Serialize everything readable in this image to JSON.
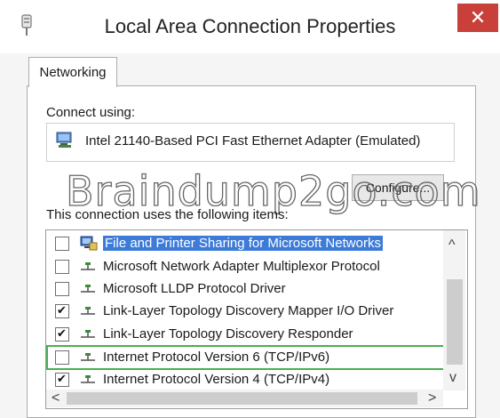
{
  "window": {
    "title": "Local Area Connection Properties",
    "close_glyph": "✕",
    "accent_close": "#c9403a"
  },
  "tabs": [
    {
      "label": "Networking",
      "active": true
    }
  ],
  "connect": {
    "label": "Connect using:",
    "adapter_name": "Intel 21140-Based PCI Fast Ethernet Adapter (Emulated)",
    "configure_label": "Configure..."
  },
  "watermark": "Braindump2go.com",
  "items": {
    "label": "This connection uses the following items:",
    "list": [
      {
        "label": "File and Printer Sharing for Microsoft Networks",
        "checked": false,
        "icon": "network-share-icon",
        "selected": true
      },
      {
        "label": "Microsoft Network Adapter Multiplexor Protocol",
        "checked": false,
        "icon": "protocol-icon"
      },
      {
        "label": "Microsoft LLDP Protocol Driver",
        "checked": false,
        "icon": "protocol-icon"
      },
      {
        "label": "Link-Layer Topology Discovery Mapper I/O Driver",
        "checked": true,
        "icon": "protocol-icon"
      },
      {
        "label": "Link-Layer Topology Discovery Responder",
        "checked": true,
        "icon": "protocol-icon"
      },
      {
        "label": "Internet Protocol Version 6 (TCP/IPv6)",
        "checked": false,
        "icon": "protocol-icon",
        "highlighted": true
      },
      {
        "label": "Internet Protocol Version 4 (TCP/IPv4)",
        "checked": true,
        "icon": "protocol-icon"
      }
    ]
  },
  "scroll": {
    "up": "^",
    "down": "v",
    "left": "<",
    "right": ">"
  },
  "colors": {
    "selection": "#3d7bd8",
    "highlight_outline": "#4caf50"
  }
}
